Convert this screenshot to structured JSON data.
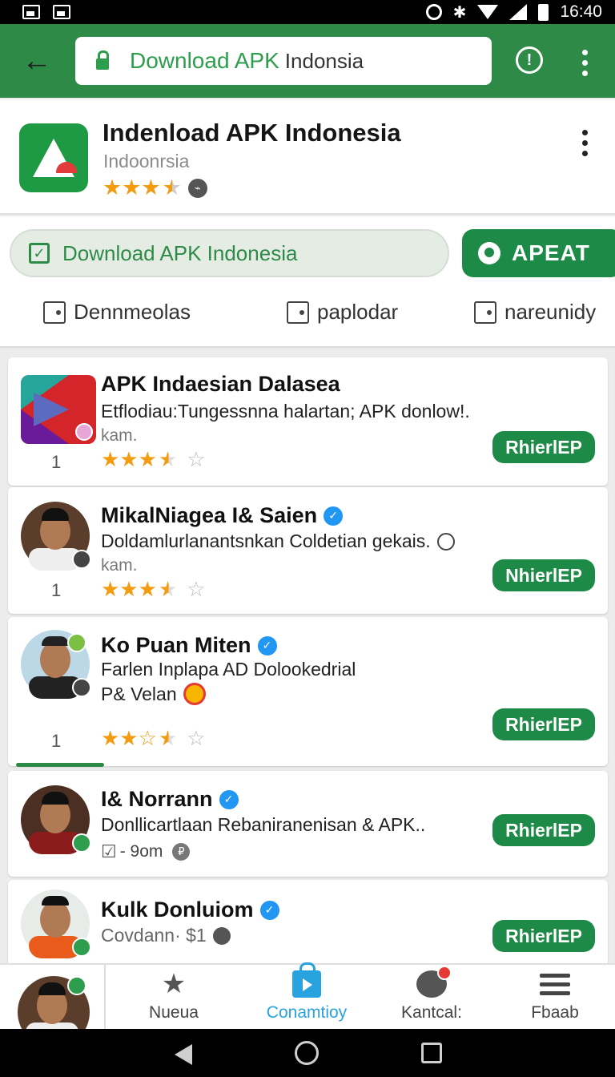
{
  "status_bar": {
    "time": "16:40"
  },
  "address_bar": {
    "url_primary": "Download APK",
    "url_secondary": "Indonsia"
  },
  "app_header": {
    "title": "Indenload APK Indonesia",
    "subtitle": "Indoonrsia",
    "stars": "★★★",
    "half_star": "★",
    "badge_glyph": "⌁"
  },
  "actions": {
    "pill_label": "Download APK Indonesia",
    "pill_check": "✓",
    "apeat_label": "APEAT"
  },
  "tabs": [
    {
      "label": "Dennmeolas"
    },
    {
      "label": "paplodar"
    },
    {
      "label": "nareunidy"
    }
  ],
  "list": [
    {
      "title": "APK Indaesian Dalasea",
      "desc": "Etflodiau:Tungessnna halartan; APK donlow!.",
      "meta": "kam.",
      "rank": "1",
      "stars": "★★★",
      "half": "★",
      "empty": "☆",
      "button": "RhierlEP"
    },
    {
      "title": "MikalNiagea I& Saien",
      "desc": "Doldamlurlanantsnkan Coldetian gekais.",
      "meta": "kam.",
      "rank": "1",
      "stars": "★★★",
      "half": "★",
      "empty": "☆",
      "button": "NhierlEP",
      "verified": "✓"
    },
    {
      "title": "Ko Puan Miten",
      "desc": "Farlen Inplapa AD Dolookedrial",
      "extra": "P& Velan",
      "rank": "1",
      "stars": "★★☆",
      "half": "★",
      "empty": "☆",
      "button": "RhierlEP",
      "verified": "✓"
    },
    {
      "title": "I& Norrann",
      "desc": "Donllicartlaan Rebaniranenisan & APK..",
      "meta_check": "☑",
      "meta": "- 9om",
      "meta_badge": "₽",
      "button": "RhierlEP",
      "verified": "✓"
    },
    {
      "title": "Kulk Donluiom",
      "desc": "Covdann· $1",
      "button": "RhierlEP",
      "verified": "✓"
    }
  ],
  "bottom_nav": [
    {
      "label": "Nueua",
      "icon": "★"
    },
    {
      "label": "Conamtioy"
    },
    {
      "label": "Kantcal:"
    },
    {
      "label": "Fbaab"
    }
  ]
}
